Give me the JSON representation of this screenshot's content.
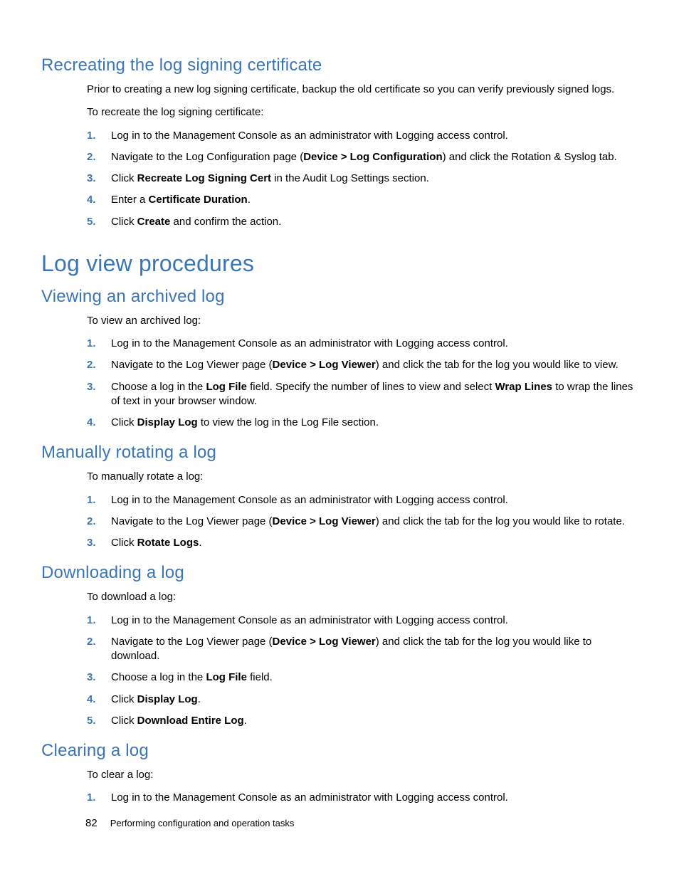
{
  "sec1": {
    "title": "Recreating the log signing certificate",
    "intro1": "Prior to creating a new log signing certificate, backup the old certificate so you can verify previously signed logs.",
    "intro2": "To recreate the log signing certificate:",
    "s1": "Log in to the Management Console as an administrator with Logging access control.",
    "s2a": "Navigate to the Log Configuration page (",
    "s2b": "Device > Log Configuration",
    "s2c": ") and click the Rotation & Syslog tab.",
    "s3a": "Click ",
    "s3b": "Recreate Log Signing Cert",
    "s3c": " in the Audit Log Settings section.",
    "s4a": "Enter a ",
    "s4b": "Certificate Duration",
    "s4c": ".",
    "s5a": "Click ",
    "s5b": "Create",
    "s5c": " and confirm the action."
  },
  "h1": "Log view procedures",
  "sec2": {
    "title": "Viewing an archived log",
    "intro": "To view an archived log:",
    "s1": "Log in to the Management Console as an administrator with Logging access control.",
    "s2a": "Navigate to the Log Viewer page (",
    "s2b": "Device > Log Viewer",
    "s2c": ") and click the tab for the log you would like to view.",
    "s3a": "Choose a log in the ",
    "s3b": "Log File",
    "s3c": " field.  Specify the number of lines to view and select ",
    "s3d": "Wrap Lines",
    "s3e": " to wrap the lines of text in your browser window.",
    "s4a": "Click ",
    "s4b": "Display Log",
    "s4c": " to view the log in the Log File section."
  },
  "sec3": {
    "title": "Manually rotating a log",
    "intro": "To manually rotate a log:",
    "s1": "Log in to the Management Console as an administrator with Logging access control.",
    "s2a": "Navigate to the Log Viewer page (",
    "s2b": "Device > Log Viewer",
    "s2c": ") and click the tab for the log you would like to rotate.",
    "s3a": "Click ",
    "s3b": "Rotate Logs",
    "s3c": "."
  },
  "sec4": {
    "title": "Downloading a log",
    "intro": "To download a log:",
    "s1": "Log in to the Management Console as an administrator with Logging access control.",
    "s2a": "Navigate to the Log Viewer page (",
    "s2b": "Device > Log Viewer",
    "s2c": ") and click the tab for the log you would like to download.",
    "s3a": "Choose a log in the ",
    "s3b": "Log File",
    "s3c": " field.",
    "s4a": "Click ",
    "s4b": "Display Log",
    "s4c": ".",
    "s5a": "Click ",
    "s5b": "Download Entire Log",
    "s5c": "."
  },
  "sec5": {
    "title": "Clearing a log",
    "intro": "To clear a log:",
    "s1": "Log in to the Management Console as an administrator with Logging access control."
  },
  "nums": {
    "n1": "1.",
    "n2": "2.",
    "n3": "3.",
    "n4": "4.",
    "n5": "5."
  },
  "footer": {
    "page": "82",
    "title": "Performing configuration and operation tasks"
  }
}
